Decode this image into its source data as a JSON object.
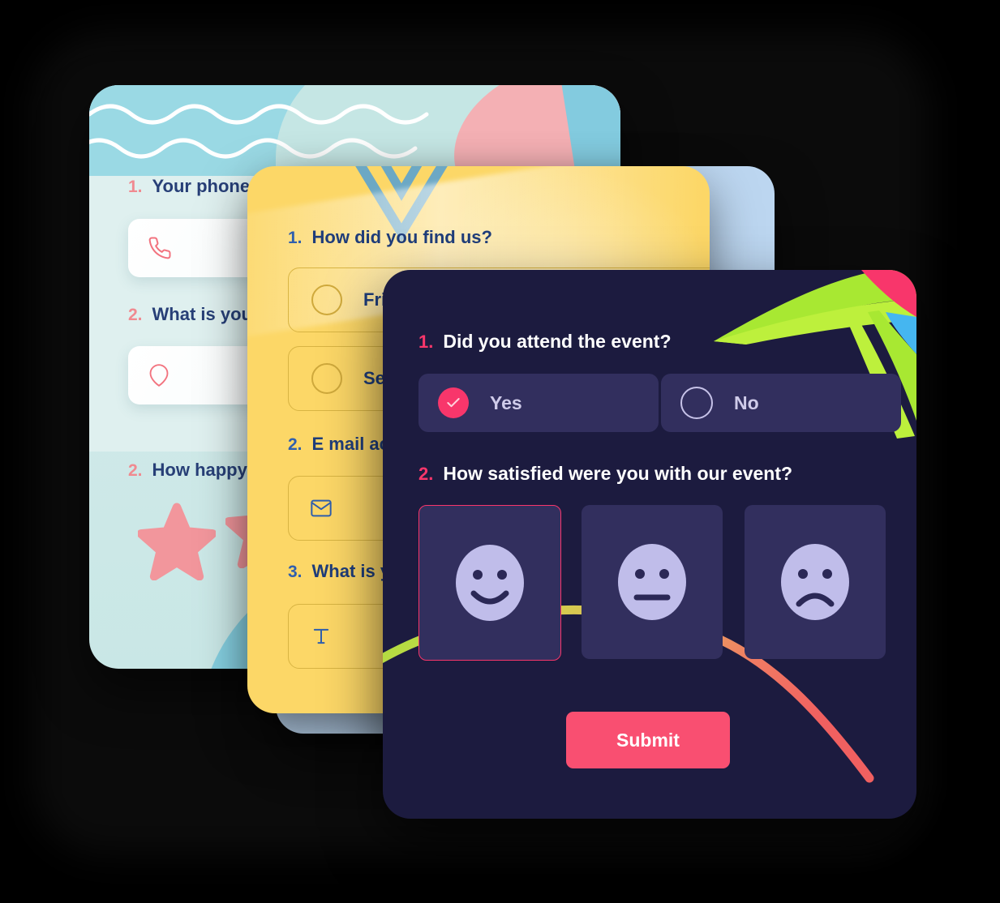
{
  "teal_card": {
    "questions": [
      {
        "num": "1.",
        "text": "Your phone"
      },
      {
        "num": "2.",
        "text": "What is you"
      },
      {
        "num": "2.",
        "text": "How happy"
      }
    ],
    "icons": {
      "phone": "phone-icon",
      "location": "location-pin-icon"
    },
    "decor": {
      "stars": "star-shape",
      "waves": "wave-lines"
    }
  },
  "yellow_card": {
    "questions": [
      {
        "num": "1.",
        "text": "How did you find us?"
      },
      {
        "num": "2.",
        "text": "E mail ac"
      },
      {
        "num": "3.",
        "text": "What is y"
      }
    ],
    "options": [
      {
        "label": "Frien",
        "selected": false
      },
      {
        "label": "Sear",
        "selected": false
      }
    ],
    "icons": {
      "email": "envelope-icon",
      "text": "text-format-icon"
    }
  },
  "dark_card": {
    "question1": {
      "num": "1.",
      "text": "Did you attend the event?"
    },
    "answers": [
      {
        "label": "Yes",
        "selected": true
      },
      {
        "label": "No",
        "selected": false
      }
    ],
    "question2": {
      "num": "2.",
      "text": "How satisfied were you with our event?"
    },
    "satisfaction": [
      {
        "face": "happy-face-icon",
        "selected": true
      },
      {
        "face": "neutral-face-icon",
        "selected": false
      },
      {
        "face": "sad-face-icon",
        "selected": false
      }
    ],
    "submit_label": "Submit"
  },
  "colors": {
    "dark_bg": "#1c1b3f",
    "dark_choice": "#322f5e",
    "accent_pink": "#f8366b",
    "submit_pink": "#f94f71",
    "face_lavender": "#c0bdea",
    "yellow_bg": "#fcd767",
    "teal_bg": "#d8eeee",
    "blue_bg": "#bcd6f0",
    "teal_hero": "#9ad9e4",
    "swoosh_green": "#a8e832",
    "swoosh_blue": "#45b6f0",
    "swoosh_pink": "#f8366b"
  }
}
